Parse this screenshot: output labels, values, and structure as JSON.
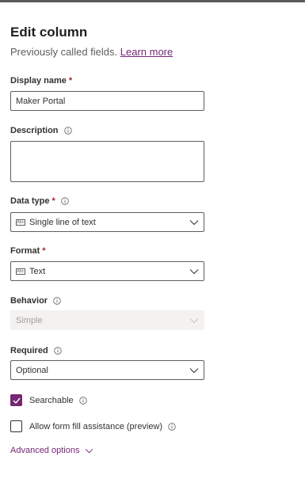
{
  "panel": {
    "title": "Edit column",
    "subtitle": "Previously called fields.",
    "learn_more": "Learn more"
  },
  "display_name": {
    "label": "Display name",
    "required_mark": "*",
    "value": "Maker Portal"
  },
  "description": {
    "label": "Description",
    "value": ""
  },
  "data_type": {
    "label": "Data type",
    "required_mark": "*",
    "value": "Single line of text",
    "icon": "text-abc-icon"
  },
  "format": {
    "label": "Format",
    "required_mark": "*",
    "value": "Text",
    "icon": "text-abc-icon"
  },
  "behavior": {
    "label": "Behavior",
    "value": "Simple",
    "disabled": true
  },
  "required": {
    "label": "Required",
    "value": "Optional"
  },
  "searchable": {
    "label": "Searchable",
    "checked": true
  },
  "form_fill": {
    "label": "Allow form fill assistance (preview)",
    "checked": false
  },
  "advanced_options": "Advanced options",
  "colors": {
    "accent": "#742774",
    "required": "#a4262c",
    "border": "#605e5c",
    "disabled_bg": "#f3f2f1"
  },
  "icon_glyph": "Abc"
}
